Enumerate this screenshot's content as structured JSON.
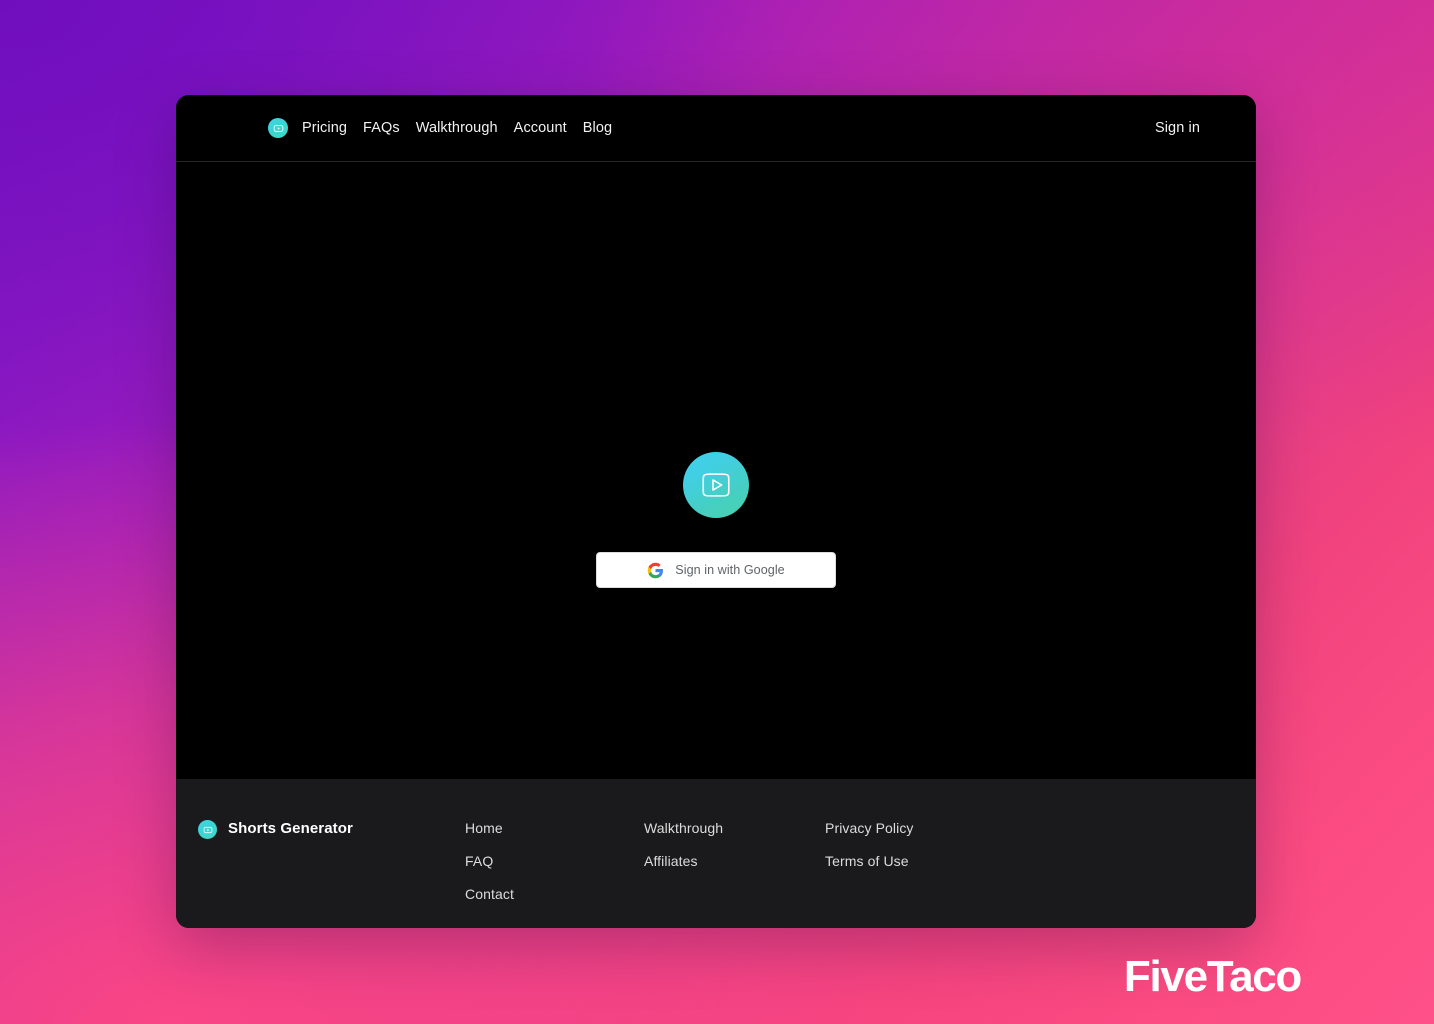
{
  "page": {
    "background_gradient_from": "#7c17c0",
    "background_gradient_mid": "#c62e9c",
    "background_gradient_to": "#fb4b82",
    "card_background": "#000000",
    "accent_color": "#41cfe2"
  },
  "header": {
    "logo_icon": "shorts-play-logo-icon",
    "nav": [
      {
        "label": "Pricing"
      },
      {
        "label": "FAQs"
      },
      {
        "label": "Walkthrough"
      },
      {
        "label": "Account"
      },
      {
        "label": "Blog"
      }
    ],
    "signin_label": "Sign in"
  },
  "main": {
    "hero_logo_icon": "youtube-play-icon",
    "google_button": {
      "icon": "google-g-icon",
      "label": "Sign in with Google"
    }
  },
  "footer": {
    "brand": {
      "logo_icon": "shorts-play-logo-icon",
      "name": "Shorts Generator"
    },
    "columns": [
      {
        "links": [
          {
            "label": "Home"
          },
          {
            "label": "FAQ"
          },
          {
            "label": "Contact"
          }
        ]
      },
      {
        "links": [
          {
            "label": "Walkthrough"
          },
          {
            "label": "Affiliates"
          }
        ]
      },
      {
        "links": [
          {
            "label": "Privacy Policy"
          },
          {
            "label": "Terms of Use"
          }
        ]
      }
    ]
  },
  "watermark": {
    "label": "FiveTaco"
  }
}
